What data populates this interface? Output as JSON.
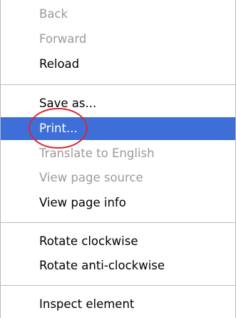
{
  "menu": {
    "items": [
      {
        "label": "Back",
        "state": "disabled"
      },
      {
        "label": "Forward",
        "state": "disabled"
      },
      {
        "label": "Reload",
        "state": "enabled"
      },
      {
        "label": "Save as...",
        "state": "enabled"
      },
      {
        "label": "Print...",
        "state": "selected"
      },
      {
        "label": "Translate to English",
        "state": "disabled"
      },
      {
        "label": "View page source",
        "state": "disabled"
      },
      {
        "label": "View page info",
        "state": "enabled"
      },
      {
        "label": "Rotate clockwise",
        "state": "enabled"
      },
      {
        "label": "Rotate anti-clockwise",
        "state": "enabled"
      },
      {
        "label": "Inspect element",
        "state": "enabled"
      }
    ]
  },
  "colors": {
    "selection": "#3e6fd8",
    "disabled_text": "#9a9a9a",
    "annotation": "#e0242b"
  }
}
